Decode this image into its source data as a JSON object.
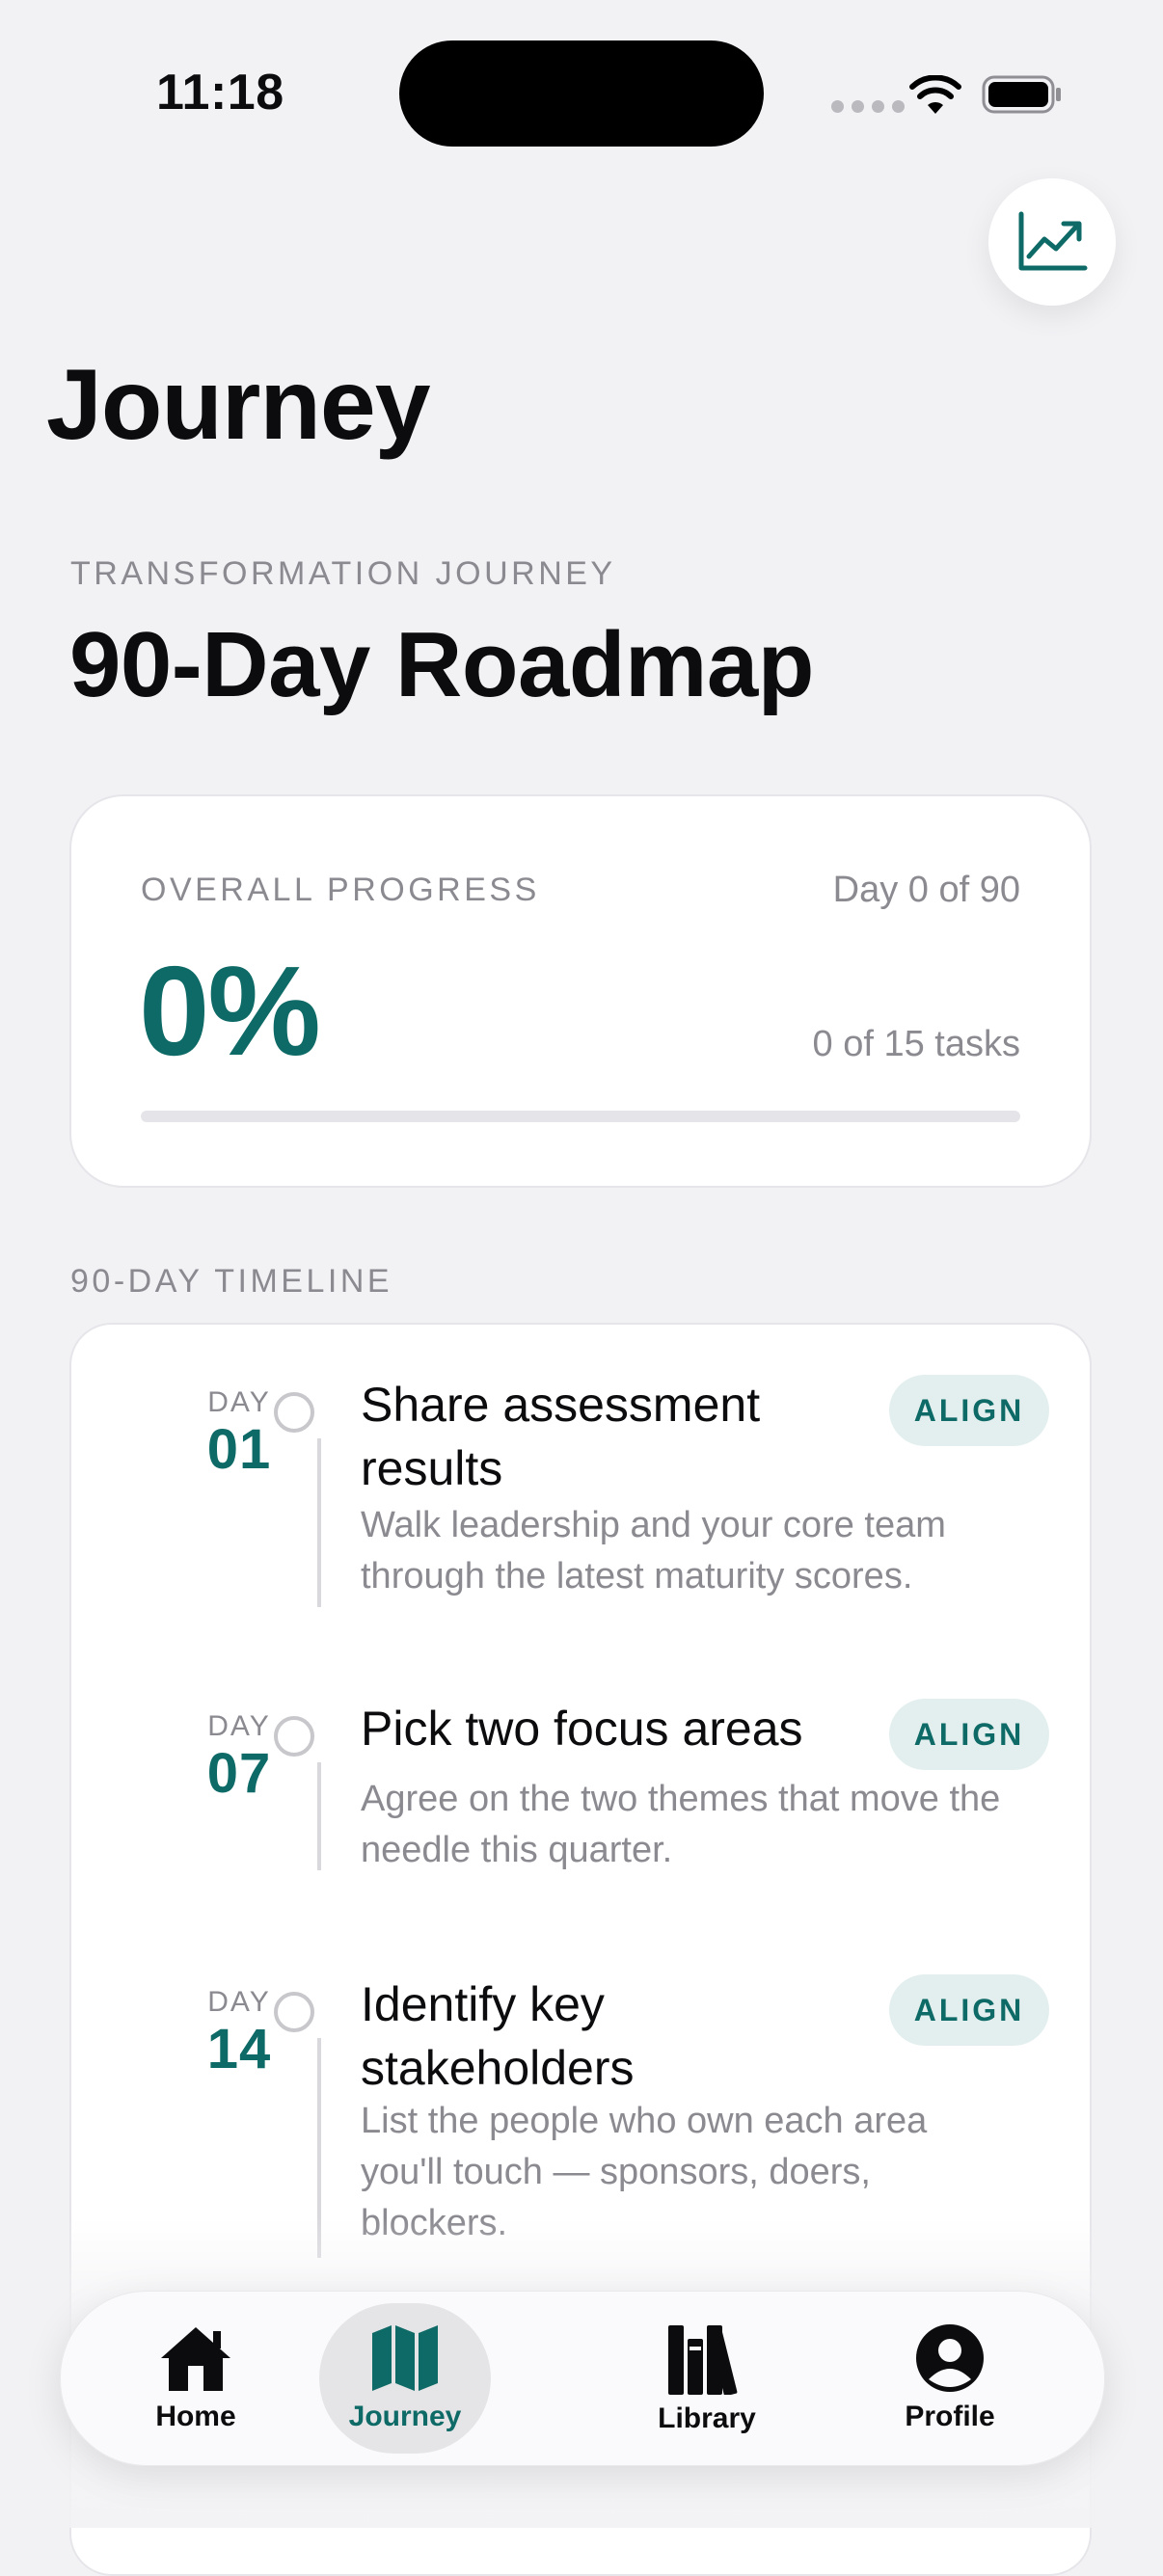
{
  "status_bar": {
    "time": "11:18"
  },
  "header": {
    "title": "Journey"
  },
  "roadmap": {
    "overline": "TRANSFORMATION JOURNEY",
    "title": "90-Day Roadmap"
  },
  "progress": {
    "label": "OVERALL PROGRESS",
    "day_text": "Day 0 of 90",
    "percent_text": "0%",
    "tasks_text": "0 of 15 tasks",
    "fraction": 0
  },
  "timeline": {
    "heading": "90-DAY TIMELINE",
    "items": [
      {
        "day_label": "DAY",
        "day": "01",
        "title": "Share assessment results",
        "description": "Walk leadership and your core team through the latest maturity scores.",
        "badge": "ALIGN"
      },
      {
        "day_label": "DAY",
        "day": "07",
        "title": "Pick two focus areas",
        "description": "Agree on the two themes that move the needle this quarter.",
        "badge": "ALIGN"
      },
      {
        "day_label": "DAY",
        "day": "14",
        "title": "Identify key stakeholders",
        "description": "List the people who own each area you'll touch — sponsors, doers, blockers.",
        "badge": "ALIGN"
      }
    ]
  },
  "tab_bar": {
    "tabs": [
      {
        "label": "Home",
        "icon": "house-icon"
      },
      {
        "label": "Journey",
        "icon": "map-icon",
        "active": true
      },
      {
        "label": "Library",
        "icon": "books-icon"
      },
      {
        "label": "Profile",
        "icon": "person-circle-icon"
      }
    ]
  },
  "colors": {
    "accent": "#0e6a66",
    "badge_bg": "#e3efee",
    "background": "#f2f2f5",
    "muted_text": "#8a8a90"
  }
}
